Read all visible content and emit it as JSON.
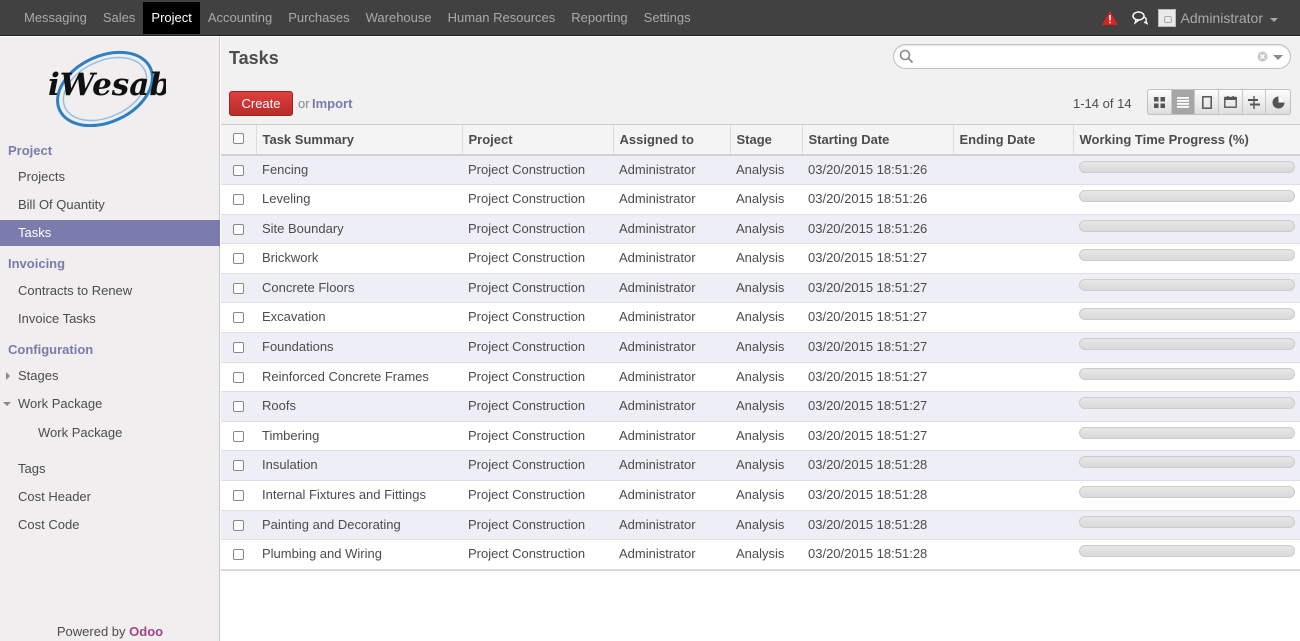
{
  "topbar": {
    "menus": [
      "Messaging",
      "Sales",
      "Project",
      "Accounting",
      "Purchases",
      "Warehouse",
      "Human Resources",
      "Reporting",
      "Settings"
    ],
    "active_menu": "Project",
    "user_name": "Administrator"
  },
  "sidebar": {
    "logo_text": "iWesabe",
    "sections": [
      {
        "title": "Project",
        "items": [
          "Projects",
          "Bill Of Quantity",
          "Tasks"
        ]
      },
      {
        "title": "Invoicing",
        "items": [
          "Contracts to Renew",
          "Invoice Tasks"
        ]
      },
      {
        "title": "Configuration",
        "items": [
          "Stages",
          "Work Package",
          "Work Package",
          "Tags",
          "Cost Header",
          "Cost Code"
        ]
      }
    ],
    "active_item": "Tasks",
    "powered_by": "Powered by",
    "powered_brand": "Odoo"
  },
  "header": {
    "title": "Tasks",
    "search_placeholder": "",
    "create_label": "Create",
    "or_label": "or",
    "import_label": "Import",
    "pager": "1-14 of 14"
  },
  "colors": {
    "accent": "#7c7bad",
    "create": "#d9372f",
    "topbar": "#414141",
    "brand": "#a24689"
  },
  "table": {
    "columns": [
      "Task Summary",
      "Project",
      "Assigned to",
      "Stage",
      "Starting Date",
      "Ending Date",
      "Working Time Progress (%)"
    ],
    "rows": [
      {
        "summary": "Fencing",
        "project": "Project Construction",
        "assigned": "Administrator",
        "stage": "Analysis",
        "start": "03/20/2015 18:51:26",
        "end": "",
        "progress": 0
      },
      {
        "summary": "Leveling",
        "project": "Project Construction",
        "assigned": "Administrator",
        "stage": "Analysis",
        "start": "03/20/2015 18:51:26",
        "end": "",
        "progress": 0
      },
      {
        "summary": "Site Boundary",
        "project": "Project Construction",
        "assigned": "Administrator",
        "stage": "Analysis",
        "start": "03/20/2015 18:51:26",
        "end": "",
        "progress": 0
      },
      {
        "summary": "Brickwork",
        "project": "Project Construction",
        "assigned": "Administrator",
        "stage": "Analysis",
        "start": "03/20/2015 18:51:27",
        "end": "",
        "progress": 0
      },
      {
        "summary": "Concrete Floors",
        "project": "Project Construction",
        "assigned": "Administrator",
        "stage": "Analysis",
        "start": "03/20/2015 18:51:27",
        "end": "",
        "progress": 0
      },
      {
        "summary": "Excavation",
        "project": "Project Construction",
        "assigned": "Administrator",
        "stage": "Analysis",
        "start": "03/20/2015 18:51:27",
        "end": "",
        "progress": 0
      },
      {
        "summary": "Foundations",
        "project": "Project Construction",
        "assigned": "Administrator",
        "stage": "Analysis",
        "start": "03/20/2015 18:51:27",
        "end": "",
        "progress": 0
      },
      {
        "summary": "Reinforced Concrete Frames",
        "project": "Project Construction",
        "assigned": "Administrator",
        "stage": "Analysis",
        "start": "03/20/2015 18:51:27",
        "end": "",
        "progress": 0
      },
      {
        "summary": "Roofs",
        "project": "Project Construction",
        "assigned": "Administrator",
        "stage": "Analysis",
        "start": "03/20/2015 18:51:27",
        "end": "",
        "progress": 0
      },
      {
        "summary": "Timbering",
        "project": "Project Construction",
        "assigned": "Administrator",
        "stage": "Analysis",
        "start": "03/20/2015 18:51:27",
        "end": "",
        "progress": 0
      },
      {
        "summary": "Insulation",
        "project": "Project Construction",
        "assigned": "Administrator",
        "stage": "Analysis",
        "start": "03/20/2015 18:51:28",
        "end": "",
        "progress": 0
      },
      {
        "summary": "Internal Fixtures and Fittings",
        "project": "Project Construction",
        "assigned": "Administrator",
        "stage": "Analysis",
        "start": "03/20/2015 18:51:28",
        "end": "",
        "progress": 0
      },
      {
        "summary": "Painting and Decorating",
        "project": "Project Construction",
        "assigned": "Administrator",
        "stage": "Analysis",
        "start": "03/20/2015 18:51:28",
        "end": "",
        "progress": 0
      },
      {
        "summary": "Plumbing and Wiring",
        "project": "Project Construction",
        "assigned": "Administrator",
        "stage": "Analysis",
        "start": "03/20/2015 18:51:28",
        "end": "",
        "progress": 0
      }
    ]
  }
}
